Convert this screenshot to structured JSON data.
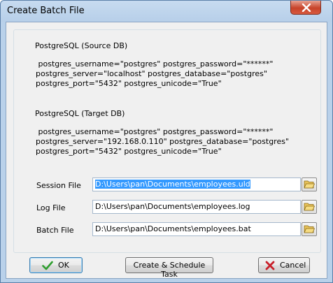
{
  "window": {
    "title": "Create Batch File"
  },
  "source": {
    "title": "PostgreSQL (Source DB)",
    "lines": [
      " postgres_username=\"postgres\" postgres_password=\"******\"",
      "postgres_server=\"localhost\" postgres_database=\"postgres\"",
      "postgres_port=\"5432\" postgres_unicode=\"True\""
    ]
  },
  "target": {
    "title": "PostgreSQL (Target DB)",
    "lines": [
      " postgres_username=\"postgres\" postgres_password=\"******\"",
      "postgres_server=\"192.168.0.110\" postgres_database=\"postgres\"",
      "postgres_port=\"5432\" postgres_unicode=\"True\""
    ]
  },
  "fields": {
    "session_label": "Session File",
    "session_value": "D:\\Users\\pan\\Documents\\employees.uld",
    "log_label": "Log File",
    "log_value": "D:\\Users\\pan\\Documents\\employees.log",
    "batch_label": "Batch File",
    "batch_value": "D:\\Users\\pan\\Documents\\employees.bat"
  },
  "buttons": {
    "ok": "OK",
    "schedule": "Create & Schedule Task",
    "cancel": "Cancel"
  },
  "icons": {
    "close": "close-icon",
    "folder": "folder-open-icon",
    "ok": "checkmark-icon",
    "cancel": "cross-icon"
  },
  "colors": {
    "selection": "#3399ff",
    "ok_check": "#2e9e2e",
    "cancel_cross": "#c8202a"
  }
}
